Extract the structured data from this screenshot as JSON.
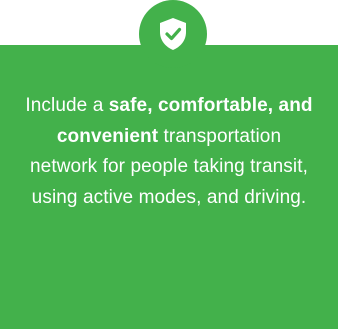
{
  "badge": {
    "icon": "shield-check-icon"
  },
  "statement": {
    "part1": "Include a ",
    "emphasis": "safe, comfortable, and convenient",
    "part2": " transportation network for people taking transit, using active modes, and driving."
  },
  "colors": {
    "card_background": "#43b14b",
    "text": "#ffffff"
  }
}
